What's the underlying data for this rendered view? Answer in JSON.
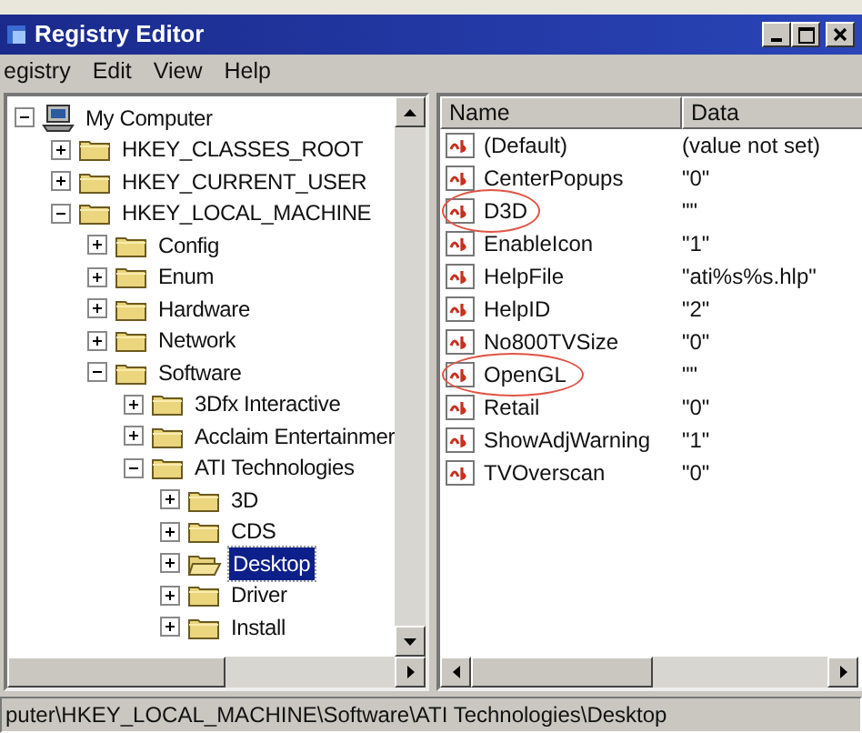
{
  "window": {
    "title": "Registry Editor"
  },
  "menu": [
    "egistry",
    "Edit",
    "View",
    "Help"
  ],
  "tree": [
    {
      "label": "My Computer",
      "expanded": true,
      "selected": false,
      "children": [
        {
          "label": "HKEY_CLASSES_ROOT",
          "expanded": false,
          "selected": false
        },
        {
          "label": "HKEY_CURRENT_USER",
          "expanded": false,
          "selected": false
        },
        {
          "label": "HKEY_LOCAL_MACHINE",
          "expanded": true,
          "selected": false,
          "children": [
            {
              "label": "Config",
              "expanded": false,
              "selected": false
            },
            {
              "label": "Enum",
              "expanded": false,
              "selected": false
            },
            {
              "label": "Hardware",
              "expanded": false,
              "selected": false
            },
            {
              "label": "Network",
              "expanded": false,
              "selected": false
            },
            {
              "label": "Software",
              "expanded": true,
              "selected": false,
              "children": [
                {
                  "label": "3Dfx Interactive",
                  "expanded": false,
                  "selected": false
                },
                {
                  "label": "Acclaim Entertainmer",
                  "expanded": false,
                  "selected": false
                },
                {
                  "label": "ATI Technologies",
                  "expanded": true,
                  "selected": false,
                  "children": [
                    {
                      "label": "3D",
                      "expanded": false,
                      "selected": false
                    },
                    {
                      "label": "CDS",
                      "expanded": false,
                      "selected": false
                    },
                    {
                      "label": "Desktop",
                      "expanded": false,
                      "selected": true
                    },
                    {
                      "label": "Driver",
                      "expanded": false,
                      "selected": false
                    },
                    {
                      "label": "Install",
                      "expanded": false,
                      "selected": false
                    }
                  ]
                }
              ]
            }
          ]
        }
      ]
    }
  ],
  "values": {
    "columns": [
      "Name",
      "Data"
    ],
    "rows": [
      {
        "name": "(Default)",
        "data": "(value not set)",
        "circled": false
      },
      {
        "name": "CenterPopups",
        "data": "\"0\"",
        "circled": false
      },
      {
        "name": "D3D",
        "data": "\"\"",
        "circled": true
      },
      {
        "name": "EnableIcon",
        "data": "\"1\"",
        "circled": false
      },
      {
        "name": "HelpFile",
        "data": "\"ati%s%s.hlp\"",
        "circled": false
      },
      {
        "name": "HelpID",
        "data": "\"2\"",
        "circled": false
      },
      {
        "name": "No800TVSize",
        "data": "\"0\"",
        "circled": false
      },
      {
        "name": "OpenGL",
        "data": "\"\"",
        "circled": true
      },
      {
        "name": "Retail",
        "data": "\"0\"",
        "circled": false
      },
      {
        "name": "ShowAdjWarning",
        "data": "\"1\"",
        "circled": false
      },
      {
        "name": "TVOverscan",
        "data": "\"0\"",
        "circled": false
      }
    ]
  },
  "status_bar": "puter\\HKEY_LOCAL_MACHINE\\Software\\ATI Technologies\\Desktop"
}
